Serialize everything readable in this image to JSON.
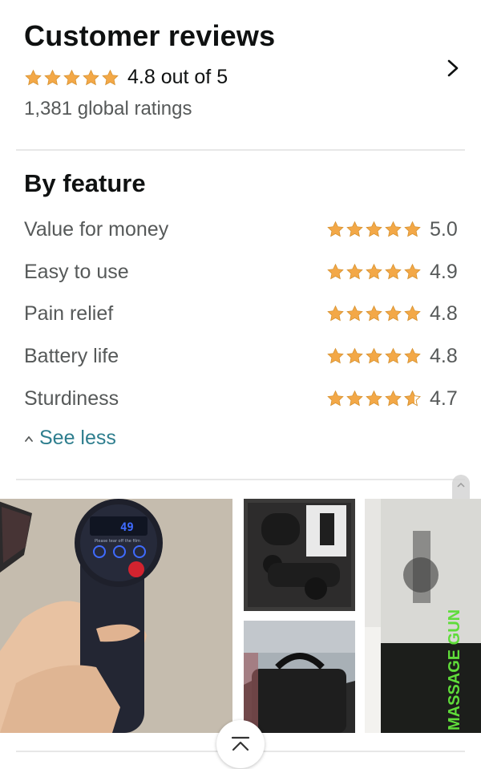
{
  "reviews": {
    "title": "Customer reviews",
    "overall": "4.8 out of 5",
    "overall_stars": 4.8,
    "global_ratings": "1,381 global ratings"
  },
  "features": {
    "title": "By feature",
    "items": [
      {
        "label": "Value for money",
        "score": "5.0",
        "stars": 5.0
      },
      {
        "label": "Easy to use",
        "score": "4.9",
        "stars": 4.9
      },
      {
        "label": "Pain relief",
        "score": "4.8",
        "stars": 4.8
      },
      {
        "label": "Battery life",
        "score": "4.8",
        "stars": 4.8
      },
      {
        "label": "Sturdiness",
        "score": "4.7",
        "stars": 4.7
      }
    ],
    "toggle_label": "See less"
  },
  "gallery": {
    "device_display": "49",
    "device_small_text": "Please tear off the film",
    "box_text": "MASSAGE GUN"
  },
  "colors": {
    "star": "#f3a847",
    "link": "#2e7e8e",
    "text_secondary": "#565959"
  },
  "icons": {
    "chevron": "chevron-right-icon",
    "see_less": "caret-up-icon",
    "back_to_top": "back-to-top-icon"
  }
}
